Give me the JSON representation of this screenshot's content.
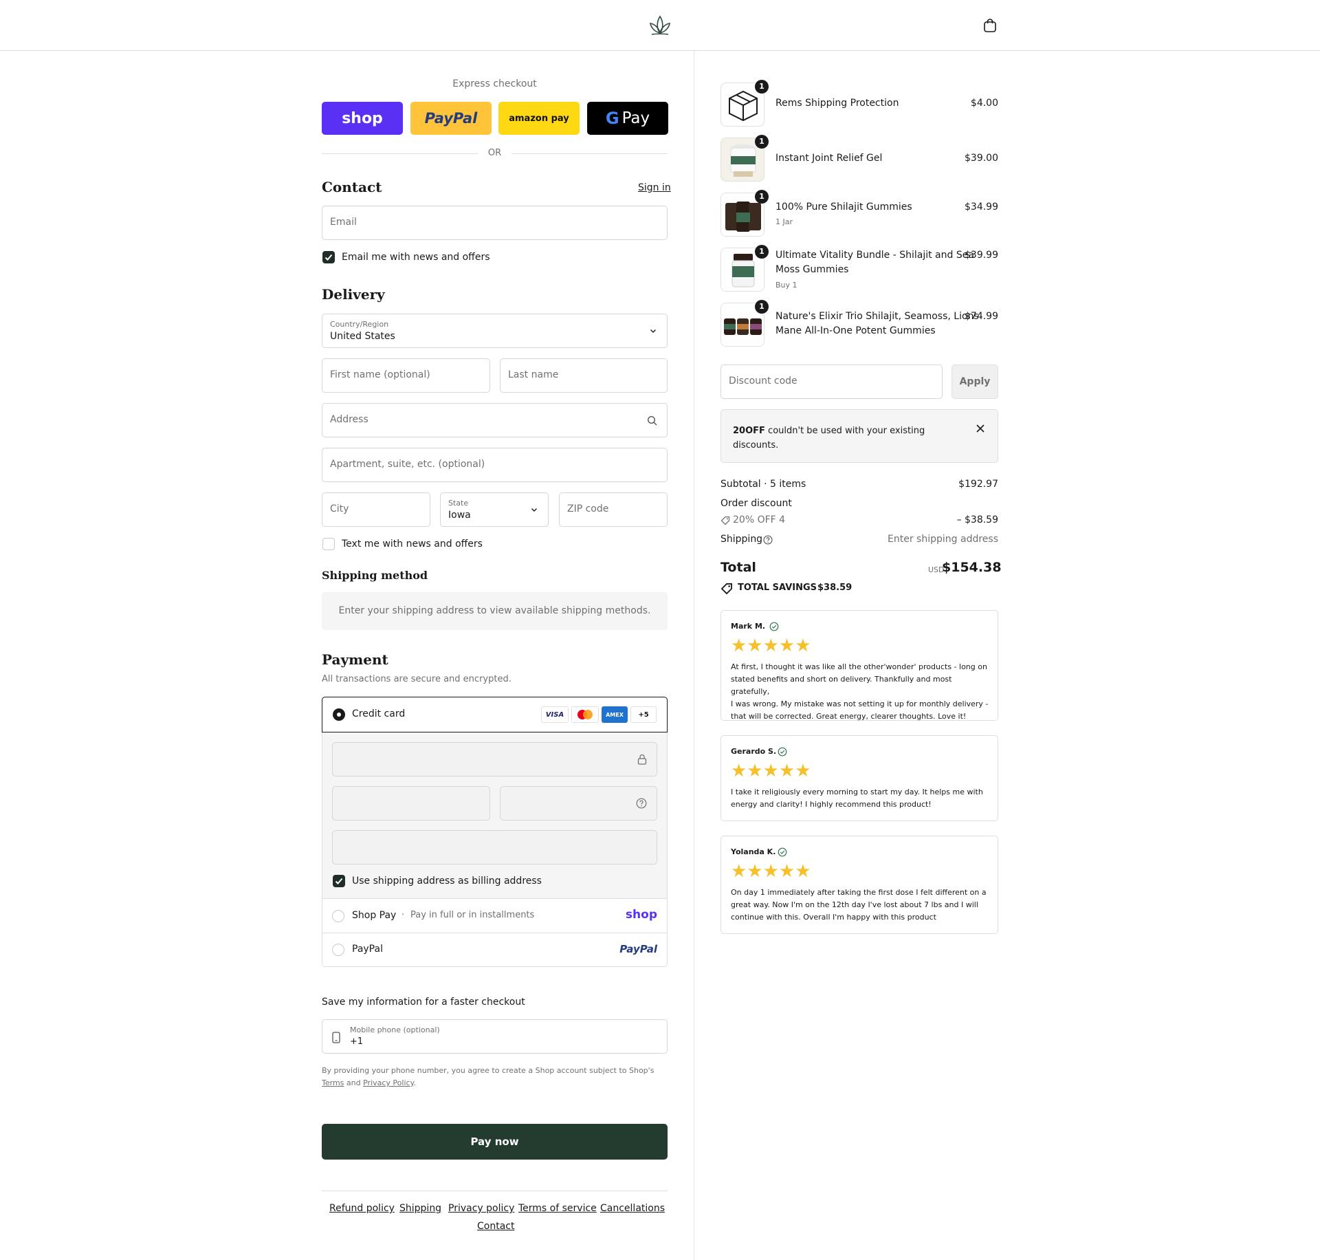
{
  "express": {
    "title": "Express checkout",
    "shop_label": "shop",
    "paypal_label": "PayPal",
    "amazon_label": "amazon pay",
    "gpay_label": "Pay",
    "or_label": "OR"
  },
  "contact": {
    "title": "Contact",
    "sign_in": "Sign in",
    "email_placeholder": "Email",
    "news_checkbox": "Email me with news and offers"
  },
  "delivery": {
    "title": "Delivery",
    "country_label": "Country/Region",
    "country_value": "United States",
    "first_name_placeholder": "First name (optional)",
    "last_name_placeholder": "Last name",
    "address_placeholder": "Address",
    "apartment_placeholder": "Apartment, suite, etc. (optional)",
    "city_placeholder": "City",
    "state_label": "State",
    "state_value": "Iowa",
    "zip_placeholder": "ZIP code",
    "text_checkbox": "Text me with news and offers"
  },
  "shipping_method": {
    "title": "Shipping method",
    "info": "Enter your shipping address to view available shipping methods."
  },
  "payment": {
    "title": "Payment",
    "subtitle": "All transactions are secure and encrypted.",
    "credit_card_label": "Credit card",
    "card_badges": [
      "VISA",
      "",
      "AMEX",
      "+5"
    ],
    "billing_checkbox": "Use shipping address as billing address",
    "shop_pay_label": "Shop Pay",
    "shop_pay_sub": "Pay in full or in installments",
    "shop_pay_logo": "shop",
    "paypal_label": "PayPal",
    "paypal_logo": "PayPal"
  },
  "save_info": {
    "title": "Save my information for a faster checkout",
    "phone_label": "Mobile phone (optional)",
    "phone_value": "+1",
    "disclaimer": "By providing your phone number, you agree to create a Shop account subject to Shop's",
    "terms": "Terms",
    "and": "and",
    "privacy": "Privacy Policy",
    "period": "."
  },
  "pay_now": "Pay now",
  "footer": {
    "links": [
      "Refund policy",
      "Shipping",
      "Privacy policy",
      "Terms of service",
      "Cancellations",
      "Contact"
    ]
  },
  "cart": {
    "items": [
      {
        "name": "Rems Shipping Protection",
        "name2": "",
        "sub": "",
        "price": "$4.00",
        "qty": "1"
      },
      {
        "name": "Instant Joint Relief Gel",
        "name2": "",
        "sub": "",
        "price": "$39.00",
        "qty": "1"
      },
      {
        "name": "100% Pure Shilajit Gummies",
        "name2": "",
        "sub": "1 Jar",
        "price": "$34.99",
        "qty": "1"
      },
      {
        "name": "Ultimate Vitality Bundle - Shilajit and Sea",
        "name2": "Moss Gummies",
        "sub": "Buy 1",
        "price": "$39.99",
        "qty": "1"
      },
      {
        "name": "Nature's Elixir Trio Shilajit, Seamoss, Lions",
        "name2": "Mane All-In-One Potent Gummies",
        "sub": "",
        "price": "$74.99",
        "qty": "1"
      }
    ],
    "discount_placeholder": "Discount code",
    "apply": "Apply",
    "notice_code": "20OFF",
    "notice_text": "couldn't be used with your existing",
    "notice_text2": "discounts.",
    "subtotal_label": "Subtotal · 5 items",
    "subtotal_value": "$192.97",
    "order_discount_label": "Order discount",
    "discount_code_label": "20% OFF 4",
    "discount_value": "– $38.59",
    "shipping_label": "Shipping",
    "shipping_value": "Enter shipping address",
    "total_label": "Total",
    "currency": "USD",
    "total_value": "$154.38",
    "savings_label": "TOTAL SAVINGS",
    "savings_value": "$38.59"
  },
  "reviews": [
    {
      "name": "Mark M.",
      "stars": "★★★★★",
      "lines": [
        "At first, I thought it was like all the other'wonder' products - long on",
        "stated benefits and short on delivery. Thankfully and most gratefully,",
        "I was wrong. My mistake was not setting it up for monthly delivery -",
        "that will be corrected. Great energy, clearer thoughts. Love it!"
      ]
    },
    {
      "name": "Gerardo S.",
      "stars": "★★★★★",
      "lines": [
        "I take it religiously every morning to start my day. It helps me with",
        "energy and clarity! I highly recommend this product!"
      ]
    },
    {
      "name": "Yolanda K.",
      "stars": "★★★★★",
      "lines": [
        "On day 1 immediately after taking the first dose I felt different on a",
        "great way. Now I'm on the 12th day I've lost about 7 lbs and I will",
        "continue with this. Overall I'm happy with this product"
      ]
    }
  ],
  "colors": {
    "brand_dark": "#243b30",
    "shop_purple": "#5a31f4",
    "paypal_yellow": "#ffc439",
    "amazon_yellow": "#ffd814",
    "star": "#f6c02b"
  }
}
